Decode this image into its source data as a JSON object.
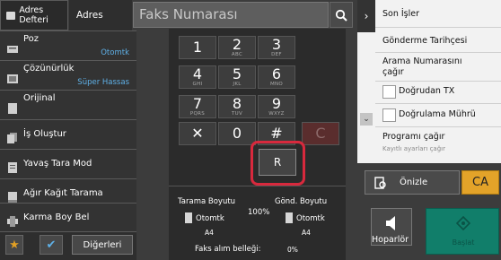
{
  "header": {
    "address_book_label": "Adres Defteri",
    "address_tab": "Adres",
    "fax_placeholder": "Faks Numarası"
  },
  "sidebar": {
    "items": [
      {
        "label": "Poz",
        "value": "Otomtk"
      },
      {
        "label": "Çözünürlük",
        "value": "Süper Hassas"
      },
      {
        "label": "Orijinal",
        "value": ""
      },
      {
        "label": "İş Oluştur",
        "value": ""
      },
      {
        "label": "Yavaş Tara Mod",
        "value": ""
      },
      {
        "label": "Ağır Kağıt Tarama",
        "value": ""
      },
      {
        "label": "Karma Boy Bel",
        "value": ""
      }
    ],
    "others_label": "Diğerleri"
  },
  "keypad": {
    "keys": [
      {
        "n": "1",
        "s": ""
      },
      {
        "n": "2",
        "s": "ABC"
      },
      {
        "n": "3",
        "s": "DEF"
      },
      {
        "n": "4",
        "s": "GHI"
      },
      {
        "n": "5",
        "s": "JKL"
      },
      {
        "n": "6",
        "s": "MNO"
      },
      {
        "n": "7",
        "s": "PQRS"
      },
      {
        "n": "8",
        "s": "TUV"
      },
      {
        "n": "9",
        "s": "WXYZ"
      },
      {
        "n": "✕",
        "s": ""
      },
      {
        "n": "0",
        "s": ""
      },
      {
        "n": "#",
        "s": ""
      }
    ],
    "clear_label": "C",
    "r_label": "R"
  },
  "scan_info": {
    "scan_size_label": "Tarama Boyutu",
    "send_size_label": "Gönd. Boyutu",
    "scan_mode": "Otomtk",
    "send_mode": "Otomtk",
    "ratio": "100%",
    "scan_paper": "A4",
    "send_paper": "A4",
    "fax_memory_label": "Faks alım belleği:",
    "fax_memory_value": "0%"
  },
  "right_panel": {
    "recent_jobs": "Son İşler",
    "send_history": "Gönderme Tarihçesi",
    "dial_call": "Arama Numarasını çağır",
    "direct_tx": "Doğrudan TX",
    "verify_stamp": "Doğrulama Mührü",
    "program_call": "Programı çağır",
    "program_sub": "Kayıtlı ayarları çağır"
  },
  "actions": {
    "preview": "Önizle",
    "ca": "CA",
    "speaker": "Hoparlör",
    "start": "Başlat"
  },
  "colors": {
    "accent_blue": "#5fb1e8",
    "highlight_red": "#d8293d",
    "ca_orange": "#e3a329",
    "start_green": "#117e6a"
  }
}
